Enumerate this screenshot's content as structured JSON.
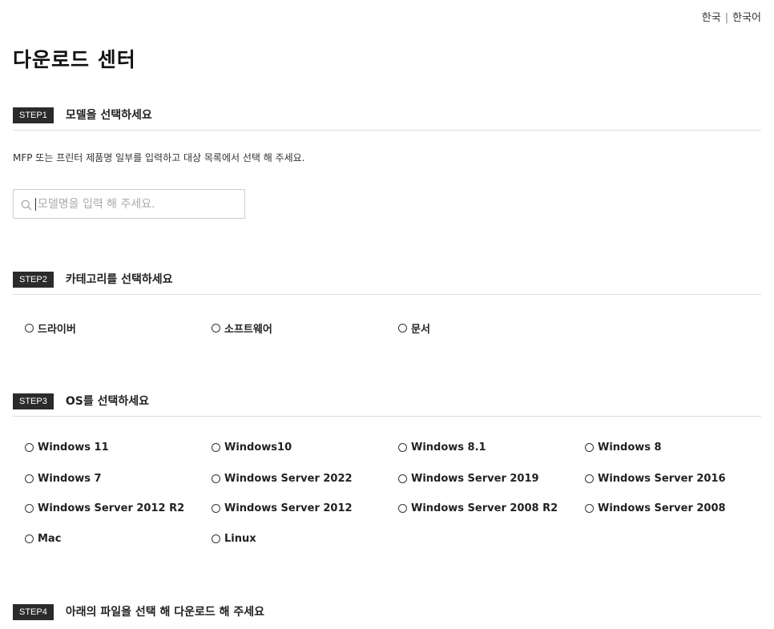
{
  "lang": {
    "country": "한국",
    "separator": "|",
    "language": "한국어"
  },
  "page_title": "다운로드 센터",
  "step1": {
    "badge": "STEP1",
    "title": "모델을 선택하세요",
    "description": "MFP 또는 프린터 제품명 일부를 입력하고 대상 목록에서 선택 해 주세요.",
    "search_placeholder": "모델명을 입력 해 주세요."
  },
  "step2": {
    "badge": "STEP2",
    "title": "카테고리를 선택하세요",
    "options": [
      "드라이버",
      "소프트웨어",
      "문서"
    ]
  },
  "step3": {
    "badge": "STEP3",
    "title": "OS를 선택하세요",
    "options": [
      "Windows 11",
      "Windows10",
      "Windows 8.1",
      "Windows 8",
      "Windows 7",
      "Windows Server 2022",
      "Windows Server 2019",
      "Windows Server 2016",
      "Windows Server 2012 R2",
      "Windows Server 2012",
      "Windows Server 2008 R2",
      "Windows Server 2008",
      "Mac",
      "Linux"
    ]
  },
  "step4": {
    "badge": "STEP4",
    "title": "아래의 파일을 선택 해 다운로드 해 주세요"
  },
  "icons": {
    "search": "search-icon",
    "radio": "radio-icon"
  },
  "colors": {
    "badge_bg": "#2b2b2b",
    "divider": "#dddddd",
    "text": "#222222",
    "placeholder": "#aaaaaa"
  }
}
